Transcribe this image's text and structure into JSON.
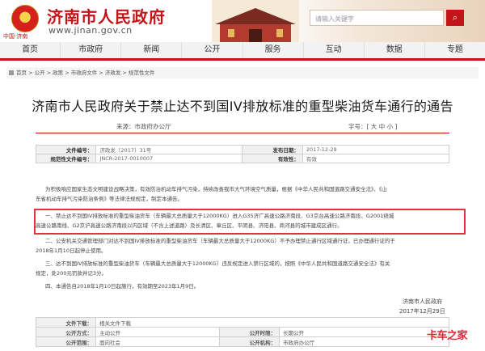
{
  "header": {
    "site_title": "济南市人民政府",
    "url": "www.jinan.gov.cn",
    "sub_label": "中国·济南",
    "search_placeholder": "请输入关键字"
  },
  "nav": [
    "首页",
    "市政府",
    "新闻",
    "公开",
    "服务",
    "互动",
    "数据",
    "专题"
  ],
  "breadcrumb": "首页 > 公开 > 政策 > 市政府文件 > 济政发 > 规范性文件",
  "doc": {
    "title": "济南市人民政府关于禁止达不到国IV排放标准的重型柴油货车通行的通告",
    "source": "来源：市政府办公厅",
    "font_size": "字号：[ 大 中 小 ]"
  },
  "meta": {
    "doc_no_label": "文件编号：",
    "doc_no": "济政发〔2017〕31号",
    "issue_date_label": "发布日期：",
    "issue_date": "2017-12-29",
    "reg_no_label": "规范性文件编号：",
    "reg_no": "JNCR-2017-0010007",
    "validity_label": "有效性：",
    "validity": "有效"
  },
  "body": {
    "intro_1": "为积极响应国家生态文明建设战略决策，有效防治机动车排气污染，持续改善我市大气环境空气质量，根据《中华人民共和国道路交通安全法》、《山",
    "intro_2": "东省机动车排气污染防治条例》等法律法规规定，制定本通告。",
    "item1_1": "一、禁止达不到国IV排放标准的重型柴油货车（车辆最大总质量大于12000KG）进入G35济广高速公路济南段、G3京台高速公路济南段、G2001绕城",
    "item1_2": "高速公路南线、G2京沪高速公路济南段以内区域（不含上述道路）及长清区、章丘区、平阴县、济阳县、商河县的城市建成区通行。",
    "item2_1": "二、公安机关交通管理部门对达不到国IV排放标准的重型柴油货车（车辆最大总质量大于12000KG）不予办理禁止通行区域通行证，已办理通行证的于",
    "item2_2": "2018年1月10日起停止使用。",
    "item3_1": "三、达不到国IV排放标准的重型柴油货车（车辆最大总质量大于12000KG）违反规定进入禁行区域的，按照《中华人民共和国道路交通安全法》有关",
    "item3_2": "规定，处200元罚款并记3分。",
    "item4": "四、本通告自2018年1月10日起施行，有效期至2023年1月9日。",
    "sign_org": "济南市人民政府",
    "sign_date": "2017年12月29日"
  },
  "footer": {
    "attach_label": "文件下载：",
    "attach": "相关文件下载",
    "open_form_label": "公开方式：",
    "open_form": "主动公开",
    "open_time_label": "公开时限：",
    "open_time": "长期公开",
    "scope_label": "公开范围：",
    "scope": "面向社会",
    "org_label": "公开机构：",
    "org": "市政府办公厅"
  },
  "watermark": "卡车之家"
}
